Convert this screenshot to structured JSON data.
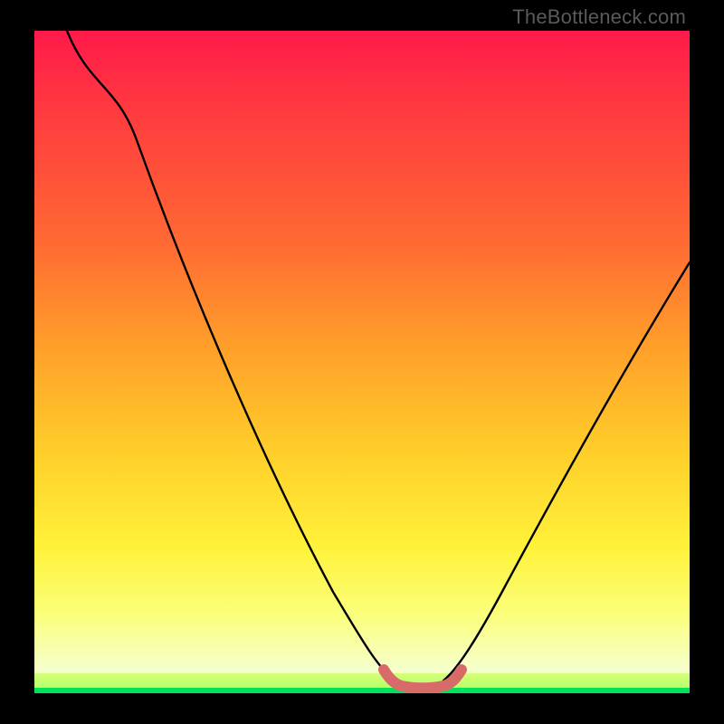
{
  "watermark": "TheBottleneck.com",
  "chart_data": {
    "type": "line",
    "title": "",
    "xlabel": "",
    "ylabel": "",
    "xlim": [
      0,
      100
    ],
    "ylim": [
      0,
      100
    ],
    "grid": false,
    "legend": false,
    "series": [
      {
        "name": "bottleneck-curve",
        "color": "#000000",
        "x": [
          5,
          10,
          15,
          20,
          25,
          30,
          35,
          40,
          45,
          50,
          52,
          55,
          58,
          60,
          62,
          65,
          70,
          80,
          90,
          100
        ],
        "y": [
          100,
          90,
          79,
          67,
          55,
          44,
          33,
          23,
          14,
          6,
          3,
          1,
          0,
          0,
          1,
          4,
          10,
          25,
          40,
          56
        ]
      },
      {
        "name": "minimum-highlight",
        "color": "#d96a6a",
        "x": [
          52,
          55,
          58,
          60,
          62
        ],
        "y": [
          3,
          1,
          0,
          0,
          1
        ]
      }
    ],
    "annotations": []
  }
}
